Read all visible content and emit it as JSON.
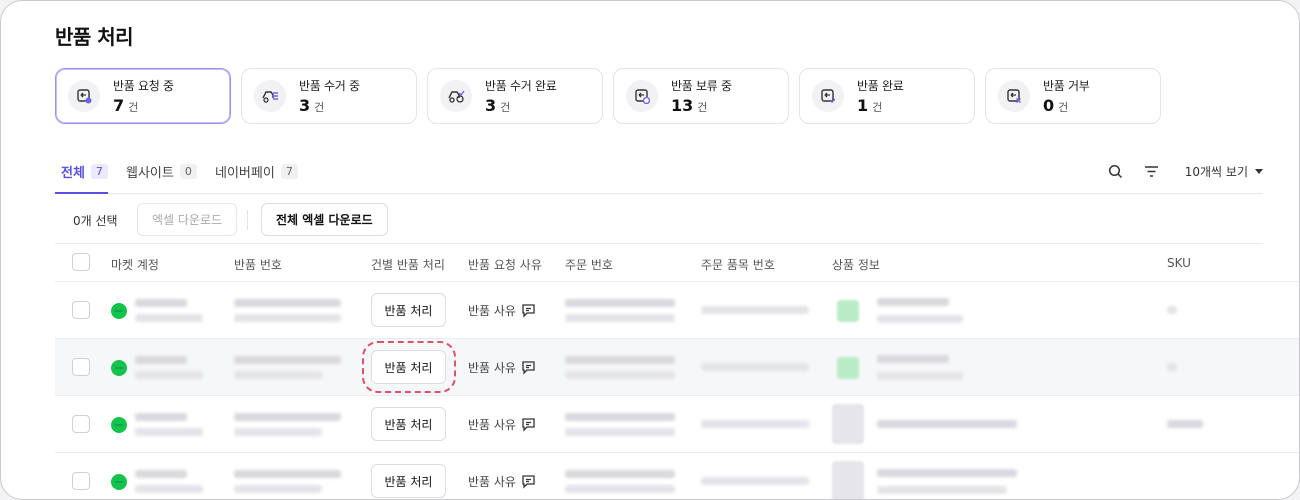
{
  "page": {
    "title": "반품 처리"
  },
  "status_cards": [
    {
      "label": "반품 요청 중",
      "count": "7",
      "unit": "건",
      "icon": "return-request-icon",
      "active": true
    },
    {
      "label": "반품 수거 중",
      "count": "3",
      "unit": "건",
      "icon": "pickup-truck-icon"
    },
    {
      "label": "반품 수거 완료",
      "count": "3",
      "unit": "건",
      "icon": "pickup-complete-icon"
    },
    {
      "label": "반품 보류 중",
      "count": "13",
      "unit": "건",
      "icon": "hold-icon"
    },
    {
      "label": "반품 완료",
      "count": "1",
      "unit": "건",
      "icon": "complete-icon"
    },
    {
      "label": "반품 거부",
      "count": "0",
      "unit": "건",
      "icon": "reject-icon"
    }
  ],
  "tabs": [
    {
      "label": "전체",
      "count": "7",
      "active": true
    },
    {
      "label": "웹사이트",
      "count": "0"
    },
    {
      "label": "네이버페이",
      "count": "7"
    }
  ],
  "toolbar": {
    "selected_count": "0개 선택",
    "excel_download": "엑셀 다운로드",
    "all_excel_download": "전체 엑셀 다운로드",
    "per_page": "10개씩 보기"
  },
  "table": {
    "columns": [
      "마켓 계정",
      "반품 번호",
      "건별 반품 처리",
      "반품 요청 사유",
      "주문 번호",
      "주문 품목 번호",
      "상품 정보",
      "SKU"
    ],
    "process_button_label": "반품 처리",
    "reason_label": "반품 사유",
    "market_icon_color": "#15c24a"
  },
  "colors": {
    "accent": "#5a4fe0",
    "highlight": "#d9536b"
  }
}
